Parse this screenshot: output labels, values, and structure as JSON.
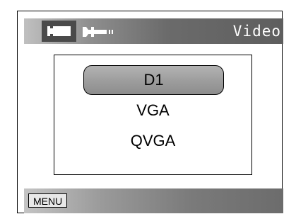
{
  "header": {
    "tabs": [
      {
        "icon": "video-camera-icon",
        "active": true
      },
      {
        "icon": "wrench-settings-icon",
        "active": false
      }
    ],
    "mode_label": "Video"
  },
  "menu": {
    "options": [
      {
        "label": "D1",
        "selected": true
      },
      {
        "label": "VGA",
        "selected": false
      },
      {
        "label": "QVGA",
        "selected": false
      }
    ]
  },
  "footer": {
    "menu_label": "MENU"
  },
  "colors": {
    "active_tab": "#4a4a4a",
    "selected_option": "#9e9e9e",
    "mode_label_text": "#ffffff"
  }
}
